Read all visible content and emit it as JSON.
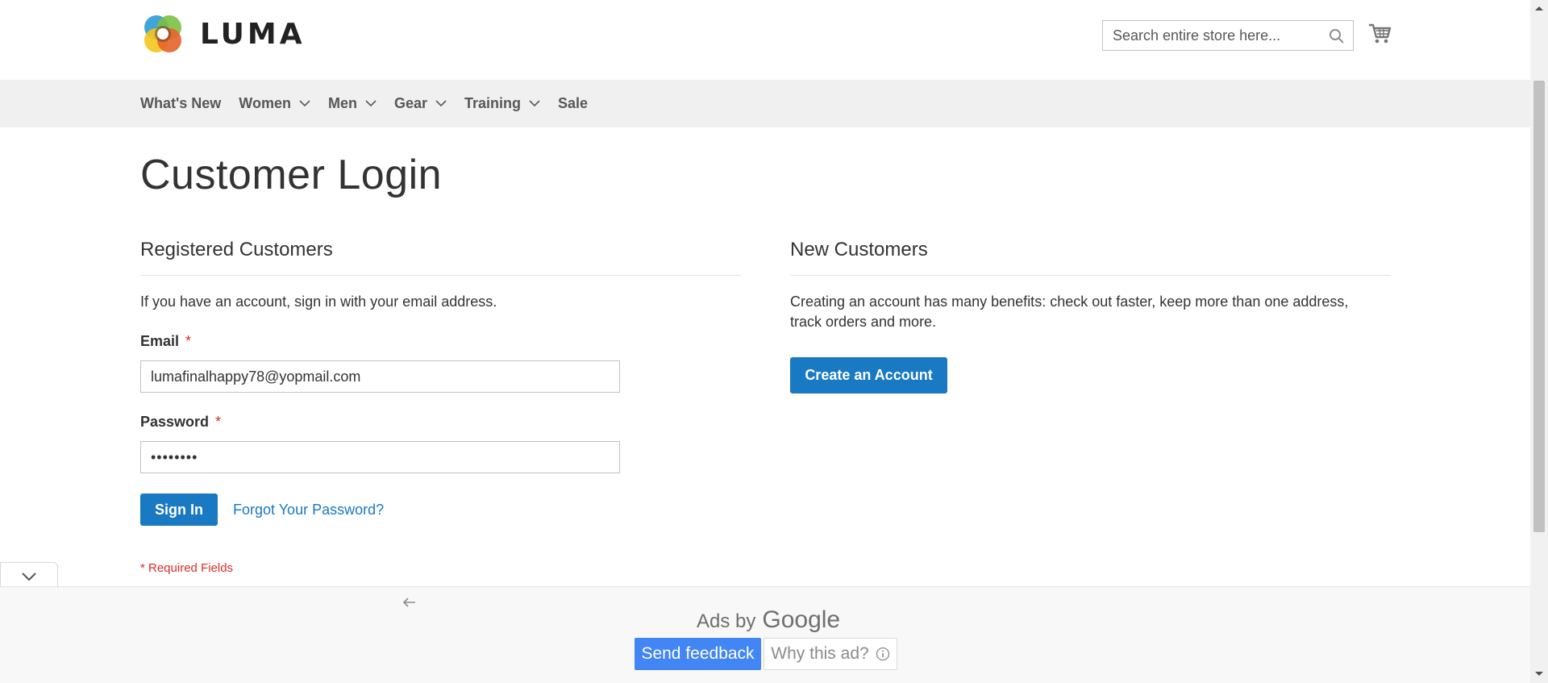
{
  "header": {
    "logo_text": "LUMA",
    "search_placeholder": "Search entire store here...",
    "icons": {
      "search": "search-icon",
      "cart": "cart-icon"
    }
  },
  "nav": {
    "items": [
      {
        "label": "What's New",
        "dropdown": false
      },
      {
        "label": "Women",
        "dropdown": true
      },
      {
        "label": "Men",
        "dropdown": true
      },
      {
        "label": "Gear",
        "dropdown": true
      },
      {
        "label": "Training",
        "dropdown": true
      },
      {
        "label": "Sale",
        "dropdown": false
      }
    ]
  },
  "page": {
    "title": "Customer Login"
  },
  "registered": {
    "title": "Registered Customers",
    "intro": "If you have an account, sign in with your email address.",
    "email_label": "Email",
    "email_value": "lumafinalhappy78@yopmail.com",
    "password_label": "Password",
    "password_value": "••••••••",
    "required_marker": "*",
    "sign_in_label": "Sign In",
    "forgot_label": "Forgot Your Password?",
    "required_note": "* Required Fields"
  },
  "new_customers": {
    "title": "New Customers",
    "line1": "Creating an account has many benefits: check out faster, keep more than one address,",
    "line2": "track orders and more.",
    "create_label": "Create an Account"
  },
  "ad": {
    "ads_by": "Ads by",
    "google": "Google",
    "send_feedback": "Send feedback",
    "why_this_ad": "Why this ad?"
  },
  "colors": {
    "primary": "#1979c3",
    "required": "#e02b27",
    "nav_bg": "#f0f0f0",
    "feedback_blue": "#4285f4"
  }
}
